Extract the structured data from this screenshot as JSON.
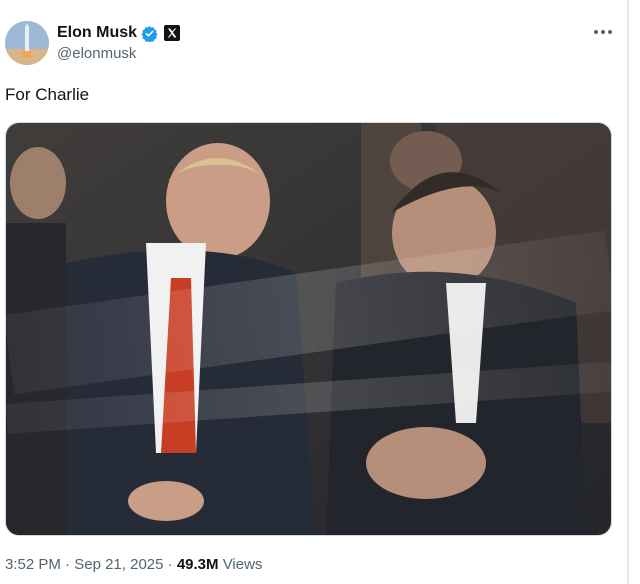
{
  "author": {
    "display_name": "Elon Musk",
    "handle": "@elonmusk",
    "verified_icon": "verified-badge-icon",
    "affiliation_icon": "x-logo-icon"
  },
  "post": {
    "text": "For Charlie",
    "media_alt": "Photo of two men in dark suits seated and talking behind a reflective glass panel",
    "time": "3:52 PM",
    "separator": "·",
    "date": "Sep 21, 2025",
    "views_count": "49.3M",
    "views_label": "Views"
  },
  "icons": {
    "more": "more-options-icon"
  },
  "colors": {
    "verified_blue": "#1d9bf0",
    "secondary_text": "#536471",
    "primary_text": "#0f1419"
  }
}
